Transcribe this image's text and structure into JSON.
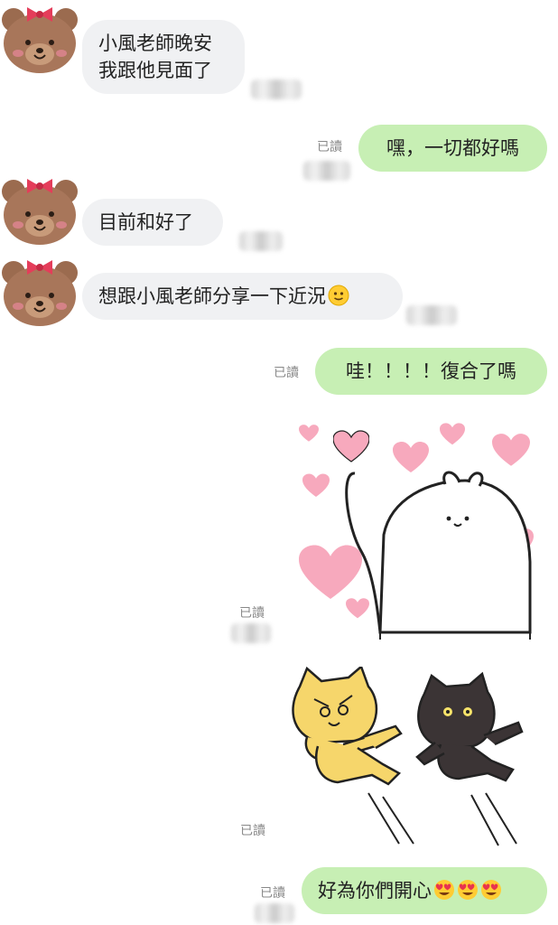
{
  "messages": [
    {
      "id": "m1",
      "side": "in",
      "text": "小風老師晚安\n我跟他見面了"
    },
    {
      "id": "m2",
      "side": "out",
      "text": "嘿，一切都好嗎",
      "read": "已讀"
    },
    {
      "id": "m3",
      "side": "in",
      "text": "目前和好了"
    },
    {
      "id": "m4",
      "side": "in",
      "text": "想跟小風老師分享一下近況",
      "emoji": "slightly-smiling-face-icon"
    },
    {
      "id": "m5",
      "side": "out",
      "text": "哇！！！！復合了嗎",
      "read": "已讀"
    },
    {
      "id": "m6",
      "side": "out",
      "sticker": "rabbit-with-hearts-sticker",
      "read": "已讀"
    },
    {
      "id": "m7",
      "side": "out",
      "sticker": "dancing-cats-sticker",
      "read": "已讀"
    },
    {
      "id": "m8",
      "side": "out",
      "text": "好為你們開心",
      "emoji": "heart-eyes-face-icon",
      "emoji_count": 3,
      "read": "已讀"
    }
  ],
  "colors": {
    "outgoing_bubble": "#c7efb4",
    "incoming_bubble": "#f0f1f3",
    "read_receipt": "#888888",
    "heart": "#f7a9bd"
  }
}
